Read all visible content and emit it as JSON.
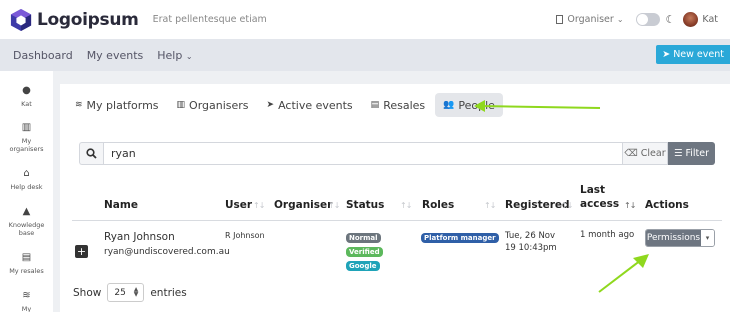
{
  "header": {
    "logo_text": "Logoipsum",
    "tagline": "Erat pellentesque etiam",
    "organiser_label": "Organiser",
    "user_name": "Kat"
  },
  "nav": {
    "items": [
      "Dashboard",
      "My events",
      "Help"
    ],
    "new_event_label": "New event"
  },
  "sidebar": {
    "items": [
      {
        "label": "Kat",
        "icon": "user-icon"
      },
      {
        "label": "My organisers",
        "icon": "building-icon"
      },
      {
        "label": "Help desk",
        "icon": "inbox-icon"
      },
      {
        "label": "Knowledge base",
        "icon": "graduation-cap-icon"
      },
      {
        "label": "My resales",
        "icon": "store-icon"
      },
      {
        "label": "My",
        "icon": "layers-icon"
      }
    ]
  },
  "tabs": [
    {
      "label": "My platforms",
      "icon": "layers-icon",
      "active": false
    },
    {
      "label": "Organisers",
      "icon": "building-icon",
      "active": false
    },
    {
      "label": "Active events",
      "icon": "paper-plane-icon",
      "active": false
    },
    {
      "label": "Resales",
      "icon": "store-icon",
      "active": false
    },
    {
      "label": "People",
      "icon": "users-icon",
      "active": true
    }
  ],
  "search": {
    "value": "ryan",
    "clear_label": "Clear",
    "filter_label": "Filter"
  },
  "table": {
    "columns": [
      "Name",
      "User",
      "Organiser",
      "Status",
      "Roles",
      "Registered",
      "Last access",
      "Actions"
    ],
    "rows": [
      {
        "name": "Ryan Johnson",
        "email": "ryan@undiscovered.com.au",
        "user": "R Johnson",
        "organiser": "",
        "status": [
          "Normal",
          "Verified",
          "Google"
        ],
        "roles": [
          "Platform manager"
        ],
        "registered": "Tue, 26 Nov 19 10:43pm",
        "last_access": "1 month ago",
        "action": "Permissions"
      }
    ]
  },
  "pagination": {
    "show_label": "Show",
    "page_size": "25",
    "entries_label": "entries"
  },
  "colors": {
    "accent": "#2aa8d8",
    "annotation_arrow": "#8fd81e",
    "badge_normal": "#6c757d",
    "badge_verified": "#5cb85c",
    "badge_google": "#1fa3b8",
    "badge_role": "#2f5fa7"
  }
}
